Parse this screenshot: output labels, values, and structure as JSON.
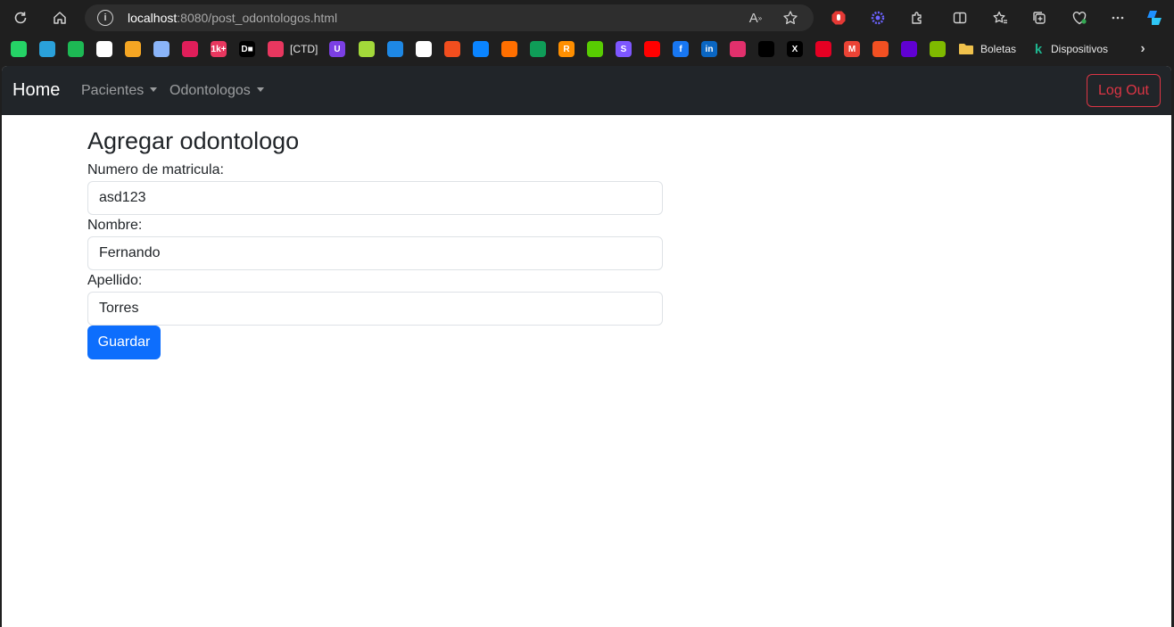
{
  "browser": {
    "url_host": "localhost",
    "url_rest": ":8080/post_odontologos.html",
    "read_aloud_label": "A",
    "bookmarks": [
      {
        "name": "whatsapp-bookmark-icon",
        "color": "#25d366",
        "glyph": ""
      },
      {
        "name": "telegram-bookmark-icon",
        "color": "#2aa1da",
        "glyph": ""
      },
      {
        "name": "spotify-bookmark-icon",
        "color": "#1db954",
        "glyph": ""
      },
      {
        "name": "chatgpt-bookmark-icon",
        "color": "#ffffff",
        "glyph": ""
      },
      {
        "name": "gmail-m-bookmark-icon",
        "color": "#f5a623",
        "glyph": ""
      },
      {
        "name": "gemini-bookmark-icon",
        "color": "#8ab4f8",
        "glyph": ""
      },
      {
        "name": "slack-bookmark-icon",
        "color": "#e01e5a",
        "glyph": ""
      },
      {
        "name": "onek-bookmark-icon",
        "color": "#e8375f",
        "glyph": "1k+"
      },
      {
        "name": "dm-bookmark-icon",
        "color": "#000000",
        "glyph": "D■"
      },
      {
        "name": "ctd-bookmark-icon",
        "color": "#e8375f",
        "glyph": ""
      },
      {
        "name": "u-bookmark-icon",
        "color": "#7b3fe4",
        "glyph": "U"
      },
      {
        "name": "green-diamond-bookmark-icon",
        "color": "#a3d93a",
        "glyph": ""
      },
      {
        "name": "window-bookmark-icon",
        "color": "#1e88e5",
        "glyph": ""
      },
      {
        "name": "github-bookmark-icon",
        "color": "#ffffff",
        "glyph": ""
      },
      {
        "name": "figma-bookmark-icon",
        "color": "#f24e1e",
        "glyph": ""
      },
      {
        "name": "vscode-bookmark-icon",
        "color": "#0a84ff",
        "glyph": ""
      },
      {
        "name": "orange-circle-bookmark-icon",
        "color": "#ff6f00",
        "glyph": ""
      },
      {
        "name": "eye-bookmark-icon",
        "color": "#0f9d58",
        "glyph": ""
      },
      {
        "name": "r-bookmark-icon",
        "color": "#ff8f00",
        "glyph": "R"
      },
      {
        "name": "duolingo-bookmark-icon",
        "color": "#58cc02",
        "glyph": ""
      },
      {
        "name": "s-bookmark-icon",
        "color": "#7e57ff",
        "glyph": "S"
      },
      {
        "name": "youtube-bookmark-icon",
        "color": "#ff0000",
        "glyph": ""
      },
      {
        "name": "facebook-bookmark-icon",
        "color": "#1877f2",
        "glyph": "f"
      },
      {
        "name": "linkedin-bookmark-icon",
        "color": "#0a66c2",
        "glyph": "in"
      },
      {
        "name": "instagram-bookmark-icon",
        "color": "#e1306c",
        "glyph": ""
      },
      {
        "name": "tiktok-bookmark-icon",
        "color": "#000000",
        "glyph": ""
      },
      {
        "name": "x-bookmark-icon",
        "color": "#000000",
        "glyph": "X"
      },
      {
        "name": "pinterest-bookmark-icon",
        "color": "#e60023",
        "glyph": ""
      },
      {
        "name": "gmail-bookmark-icon",
        "color": "#ea4335",
        "glyph": "M"
      },
      {
        "name": "microsoft-bookmark-icon",
        "color": "#f25022",
        "glyph": ""
      },
      {
        "name": "mail-bookmark-icon",
        "color": "#6001d2",
        "glyph": ""
      },
      {
        "name": "microsoft2-bookmark-icon",
        "color": "#7fba00",
        "glyph": ""
      }
    ],
    "ctd_label": "[CTD]",
    "folder_label": "Boletas",
    "devices_label": "Dispositivos"
  },
  "navbar": {
    "brand": "Home",
    "menu_pacientes": "Pacientes",
    "menu_odontologos": "Odontologos",
    "logout": "Log Out"
  },
  "form": {
    "title": "Agregar odontologo",
    "matricula_label": "Numero de matricula:",
    "matricula_value": "asd123",
    "nombre_label": "Nombre:",
    "nombre_value": "Fernando",
    "apellido_label": "Apellido:",
    "apellido_value": "Torres",
    "submit": "Guardar"
  },
  "colors": {
    "navbar_bg": "#212529",
    "primary": "#0d6efd",
    "danger": "#dc3545"
  }
}
